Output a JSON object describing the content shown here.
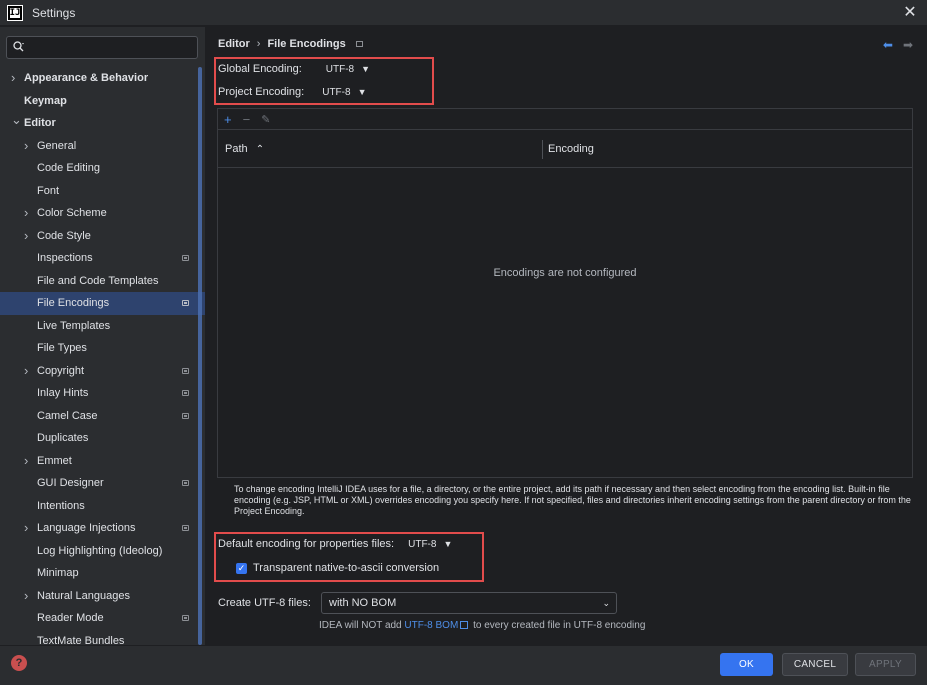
{
  "window": {
    "title": "Settings",
    "app_logo_text": "IJ"
  },
  "search": {
    "placeholder": "",
    "value": ""
  },
  "sidebar": {
    "items": [
      {
        "label": "Appearance & Behavior",
        "level": 0,
        "chevron": "right",
        "bold": true,
        "badge": false
      },
      {
        "label": "Keymap",
        "level": 0,
        "chevron": "",
        "bold": true,
        "badge": false
      },
      {
        "label": "Editor",
        "level": 0,
        "chevron": "down",
        "bold": true,
        "badge": false
      },
      {
        "label": "General",
        "level": 1,
        "chevron": "right",
        "badge": false
      },
      {
        "label": "Code Editing",
        "level": 1,
        "chevron": "",
        "badge": false
      },
      {
        "label": "Font",
        "level": 1,
        "chevron": "",
        "badge": false
      },
      {
        "label": "Color Scheme",
        "level": 1,
        "chevron": "right",
        "badge": false
      },
      {
        "label": "Code Style",
        "level": 1,
        "chevron": "right",
        "badge": false
      },
      {
        "label": "Inspections",
        "level": 1,
        "chevron": "",
        "badge": true
      },
      {
        "label": "File and Code Templates",
        "level": 1,
        "chevron": "",
        "badge": false
      },
      {
        "label": "File Encodings",
        "level": 1,
        "chevron": "",
        "badge": true,
        "selected": true
      },
      {
        "label": "Live Templates",
        "level": 1,
        "chevron": "",
        "badge": false
      },
      {
        "label": "File Types",
        "level": 1,
        "chevron": "",
        "badge": false
      },
      {
        "label": "Copyright",
        "level": 1,
        "chevron": "right",
        "badge": true
      },
      {
        "label": "Inlay Hints",
        "level": 1,
        "chevron": "",
        "badge": true
      },
      {
        "label": "Camel Case",
        "level": 1,
        "chevron": "",
        "badge": true
      },
      {
        "label": "Duplicates",
        "level": 1,
        "chevron": "",
        "badge": false
      },
      {
        "label": "Emmet",
        "level": 1,
        "chevron": "right",
        "badge": false
      },
      {
        "label": "GUI Designer",
        "level": 1,
        "chevron": "",
        "badge": true
      },
      {
        "label": "Intentions",
        "level": 1,
        "chevron": "",
        "badge": false
      },
      {
        "label": "Language Injections",
        "level": 1,
        "chevron": "right",
        "badge": true
      },
      {
        "label": "Log Highlighting (Ideolog)",
        "level": 1,
        "chevron": "",
        "badge": false
      },
      {
        "label": "Minimap",
        "level": 1,
        "chevron": "",
        "badge": false
      },
      {
        "label": "Natural Languages",
        "level": 1,
        "chevron": "right",
        "badge": false
      },
      {
        "label": "Reader Mode",
        "level": 1,
        "chevron": "",
        "badge": true
      },
      {
        "label": "TextMate Bundles",
        "level": 1,
        "chevron": "",
        "badge": false
      }
    ]
  },
  "breadcrumb": {
    "parent": "Editor",
    "separator": "›",
    "current": "File Encodings"
  },
  "encodings": {
    "global_label": "Global Encoding:",
    "global_value": "UTF-8",
    "project_label": "Project Encoding:",
    "project_value": "UTF-8"
  },
  "table": {
    "add": "+",
    "remove": "−",
    "edit": "✎",
    "col_path": "Path",
    "col_path_sort": "⌃",
    "col_encoding": "Encoding",
    "empty_text": "Encodings are not configured"
  },
  "help_text": "To change encoding IntelliJ IDEA uses for a file, a directory, or the entire project, add its path if necessary and then select encoding from the encoding list. Built-in file encoding (e.g. JSP, HTML or XML) overrides encoding you specify here. If not specified, files and directories inherit encoding settings from the parent directory or from the Project Encoding.",
  "properties": {
    "label": "Default encoding for properties files:",
    "value": "UTF-8",
    "native_to_ascii_label": "Transparent native-to-ascii conversion",
    "native_to_ascii_checked": true
  },
  "bom": {
    "label": "Create UTF-8 files:",
    "value": "with NO BOM",
    "note_prefix": "IDEA will NOT add",
    "note_link": "UTF-8 BOM",
    "note_suffix": "to every created file in UTF-8 encoding"
  },
  "footer": {
    "ok": "OK",
    "cancel": "CANCEL",
    "apply": "APPLY",
    "help_glyph": "?"
  },
  "colors": {
    "accent": "#3574f0",
    "highlight_box": "#e24c4c",
    "selection": "#2e436e"
  }
}
